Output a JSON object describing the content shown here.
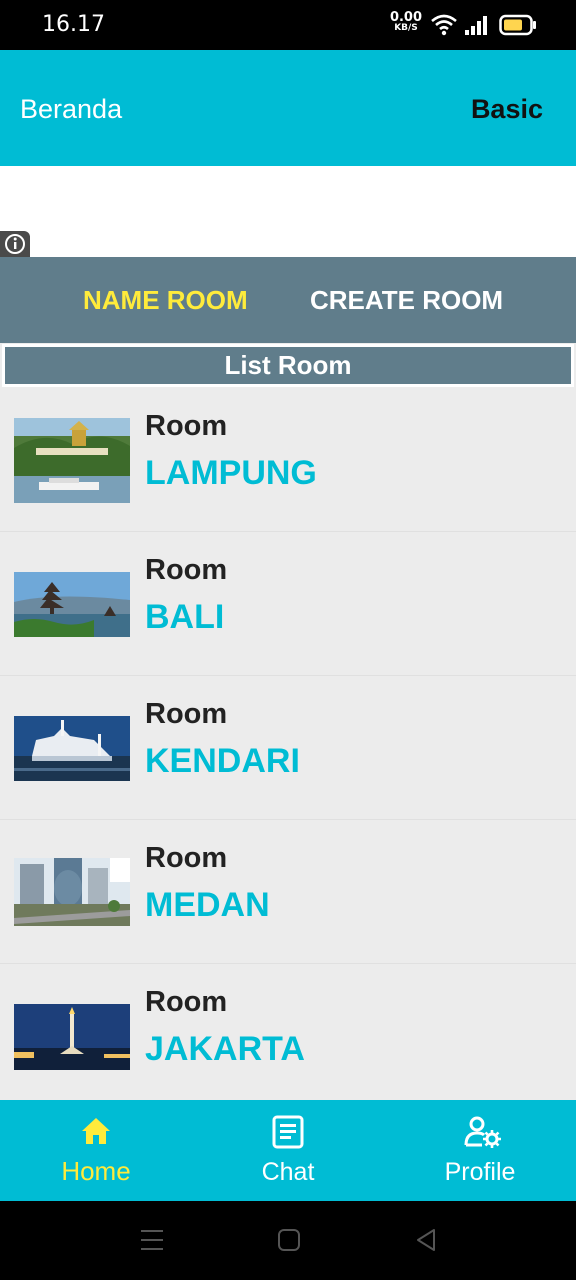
{
  "status": {
    "time": "16.17",
    "speed_value": "0.00",
    "speed_unit": "KB/S",
    "icons": [
      "wifi-icon",
      "signal-icon",
      "battery-icon"
    ]
  },
  "appbar": {
    "title": "Beranda",
    "plan": "Basic"
  },
  "tabs": {
    "name_room": "NAME ROOM",
    "create_room": "CREATE ROOM"
  },
  "list": {
    "header": "List Room",
    "items": [
      {
        "label": "Room",
        "city": "LAMPUNG"
      },
      {
        "label": "Room",
        "city": "BALI"
      },
      {
        "label": "Room",
        "city": "KENDARI"
      },
      {
        "label": "Room",
        "city": "MEDAN"
      },
      {
        "label": "Room",
        "city": "JAKARTA"
      }
    ]
  },
  "bottom_nav": {
    "home": "Home",
    "chat": "Chat",
    "profile": "Profile"
  },
  "colors": {
    "primary": "#00bcd4",
    "tab_bar": "#607d8b",
    "active": "#ffeb3b"
  }
}
